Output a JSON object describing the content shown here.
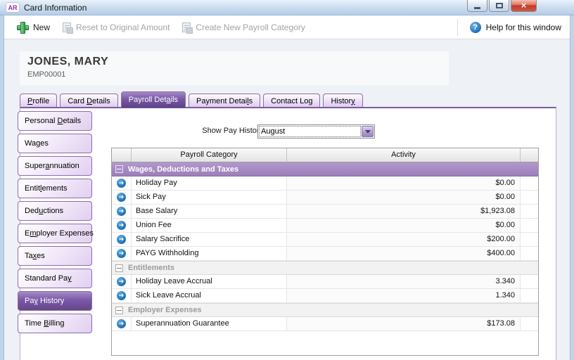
{
  "window": {
    "title": "Card Information",
    "app_icon": "AR"
  },
  "toolbar": {
    "new_label": "New",
    "reset_label": "Reset to Original Amount",
    "create_label": "Create New Payroll Category",
    "help_label": "Help for this window"
  },
  "employee": {
    "name": "JONES, MARY",
    "id": "EMP00001"
  },
  "tabs": [
    {
      "pre": "",
      "accel": "P",
      "post": "rofile",
      "selected": false
    },
    {
      "pre": "Card ",
      "accel": "D",
      "post": "etails",
      "selected": false
    },
    {
      "pre": "Payroll Det",
      "accel": "a",
      "post": "ils",
      "selected": true
    },
    {
      "pre": "Payment Detai",
      "accel": "l",
      "post": "s",
      "selected": false
    },
    {
      "pre": "Contact Lo",
      "accel": "g",
      "post": "",
      "selected": false
    },
    {
      "pre": "Histor",
      "accel": "y",
      "post": "",
      "selected": false
    }
  ],
  "sidebar": {
    "items": [
      {
        "pre": "Personal ",
        "accel": "D",
        "post": "etails",
        "selected": false
      },
      {
        "pre": "Wa",
        "accel": "g",
        "post": "es",
        "selected": false
      },
      {
        "pre": "Super",
        "accel": "a",
        "post": "nnuation",
        "selected": false
      },
      {
        "pre": "Entit",
        "accel": "l",
        "post": "ements",
        "selected": false
      },
      {
        "pre": "Ded",
        "accel": "u",
        "post": "ctions",
        "selected": false
      },
      {
        "pre": "E",
        "accel": "m",
        "post": "ployer Expenses",
        "selected": false
      },
      {
        "pre": "Ta",
        "accel": "x",
        "post": "es",
        "selected": false
      },
      {
        "pre": "Standard Pa",
        "accel": "y",
        "post": "",
        "selected": false
      },
      {
        "pre": "Pa",
        "accel": "y",
        "post": " History",
        "selected": true
      },
      {
        "pre": "Time ",
        "accel": "B",
        "post": "illing",
        "selected": false
      }
    ]
  },
  "pay_history": {
    "label": "Show Pay History for:",
    "selected": "August"
  },
  "table": {
    "columns": [
      "",
      "Payroll Category",
      "Activity",
      ""
    ],
    "groups": [
      {
        "label": "Wages, Deductions and Taxes",
        "style": "purple",
        "rows": [
          {
            "category": "Holiday Pay",
            "activity": "$0.00"
          },
          {
            "category": "Sick Pay",
            "activity": "$0.00"
          },
          {
            "category": "Base Salary",
            "activity": "$1,923.08"
          },
          {
            "category": "Union Fee",
            "activity": "$0.00"
          },
          {
            "category": "Salary Sacrifice",
            "activity": "$200.00"
          },
          {
            "category": "PAYG Withholding",
            "activity": "$400.00"
          }
        ]
      },
      {
        "label": "Entitlements",
        "style": "plain",
        "rows": [
          {
            "category": "Holiday Leave Accrual",
            "activity": "3.340"
          },
          {
            "category": "Sick Leave Accrual",
            "activity": "1.340"
          }
        ]
      },
      {
        "label": "Employer Expenses",
        "style": "plain",
        "rows": [
          {
            "category": "Superannuation Guarantee",
            "activity": "$173.08"
          }
        ]
      }
    ]
  },
  "icons": {
    "app": "AR-badge",
    "new": "green-plus",
    "reset": "document-refresh",
    "create": "document-plus",
    "help": "question-circle",
    "row_detail": "arrow-right-circle",
    "collapse": "minus-box",
    "dropdown": "chevron-down",
    "minimize": "minimize-bar",
    "maximize": "restore-box",
    "close": "close-x"
  },
  "colors": {
    "titlebar_blue": "#b6cde7",
    "accent_purple": "#8e6cae",
    "selected_purple": "#6a4b96",
    "group_header_purple": "#a78dc3",
    "arrow_blue": "#1f73b5",
    "help_blue": "#2e86c9",
    "new_green": "#2e9e44",
    "close_red": "#c23a28"
  }
}
